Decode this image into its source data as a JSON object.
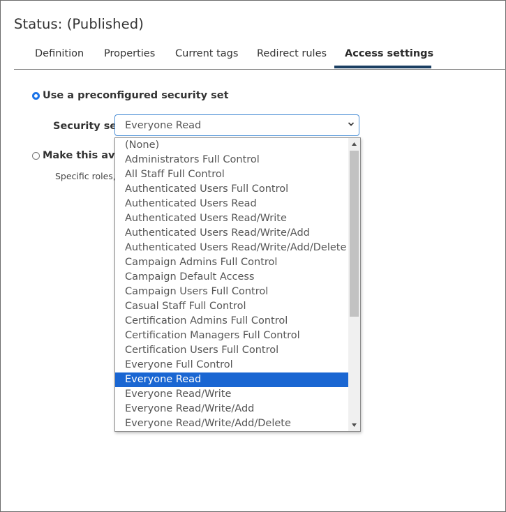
{
  "page": {
    "title": "Status: (Published)"
  },
  "tabs": [
    {
      "label": "Definition",
      "active": false
    },
    {
      "label": "Properties",
      "active": false
    },
    {
      "label": "Current tags",
      "active": false
    },
    {
      "label": "Redirect rules",
      "active": false
    },
    {
      "label": "Access settings",
      "active": true
    }
  ],
  "access": {
    "option_preconfigured": {
      "label": "Use a preconfigured security set",
      "checked": true
    },
    "option_make_available": {
      "label": "Make this avai",
      "checked": false
    },
    "helper_text": "Specific roles,",
    "security_set_label": "Security set",
    "security_set_value": "Everyone Read"
  },
  "dropdown": {
    "selected": "Everyone Read",
    "options": [
      "(None)",
      "Administrators Full Control",
      "All Staff Full Control",
      "Authenticated Users Full Control",
      "Authenticated Users Read",
      "Authenticated Users Read/Write",
      "Authenticated Users Read/Write/Add",
      "Authenticated Users Read/Write/Add/Delete",
      "Campaign Admins Full Control",
      "Campaign Default Access",
      "Campaign Users Full Control",
      "Casual Staff Full Control",
      "Certification Admins Full Control",
      "Certification Managers Full Control",
      "Certification Users Full Control",
      "Everyone Full Control",
      "Everyone Read",
      "Everyone Read/Write",
      "Everyone Read/Write/Add",
      "Everyone Read/Write/Add/Delete"
    ]
  },
  "colors": {
    "accent": "#1a66d2",
    "tab_underline": "#1b3f62",
    "select_border": "#4d90d6"
  }
}
